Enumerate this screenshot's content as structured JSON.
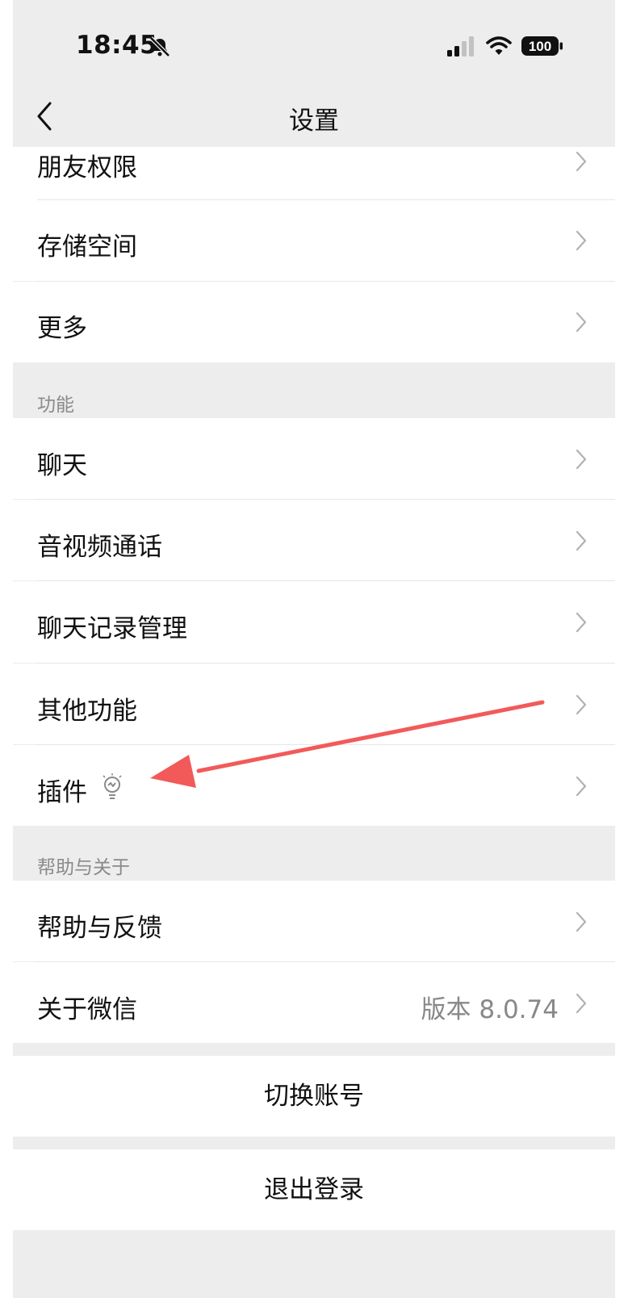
{
  "status_bar": {
    "time": "18:45",
    "battery": "100"
  },
  "nav": {
    "title": "设置"
  },
  "items_top": [
    {
      "label": "朋友权限"
    },
    {
      "label": "存储空间"
    },
    {
      "label": "更多"
    }
  ],
  "section_features": {
    "title": "功能"
  },
  "items_features": [
    {
      "label": "聊天"
    },
    {
      "label": "音视频通话"
    },
    {
      "label": "聊天记录管理"
    },
    {
      "label": "其他功能"
    },
    {
      "label": "插件"
    }
  ],
  "section_help": {
    "title": "帮助与关于"
  },
  "items_help": [
    {
      "label": "帮助与反馈"
    },
    {
      "label": "关于微信",
      "value": "版本 8.0.74"
    }
  ],
  "buttons": {
    "switch_account": "切换账号",
    "logout": "退出登录"
  },
  "colors": {
    "background": "#ededed",
    "cell": "#ffffff",
    "annotation_arrow": "#f25a5a"
  },
  "icons": [
    "bell-slash-icon",
    "signal-icon",
    "wifi-icon",
    "battery-icon",
    "back-icon",
    "chevron-right-icon",
    "plugin-lightbulb-icon"
  ]
}
